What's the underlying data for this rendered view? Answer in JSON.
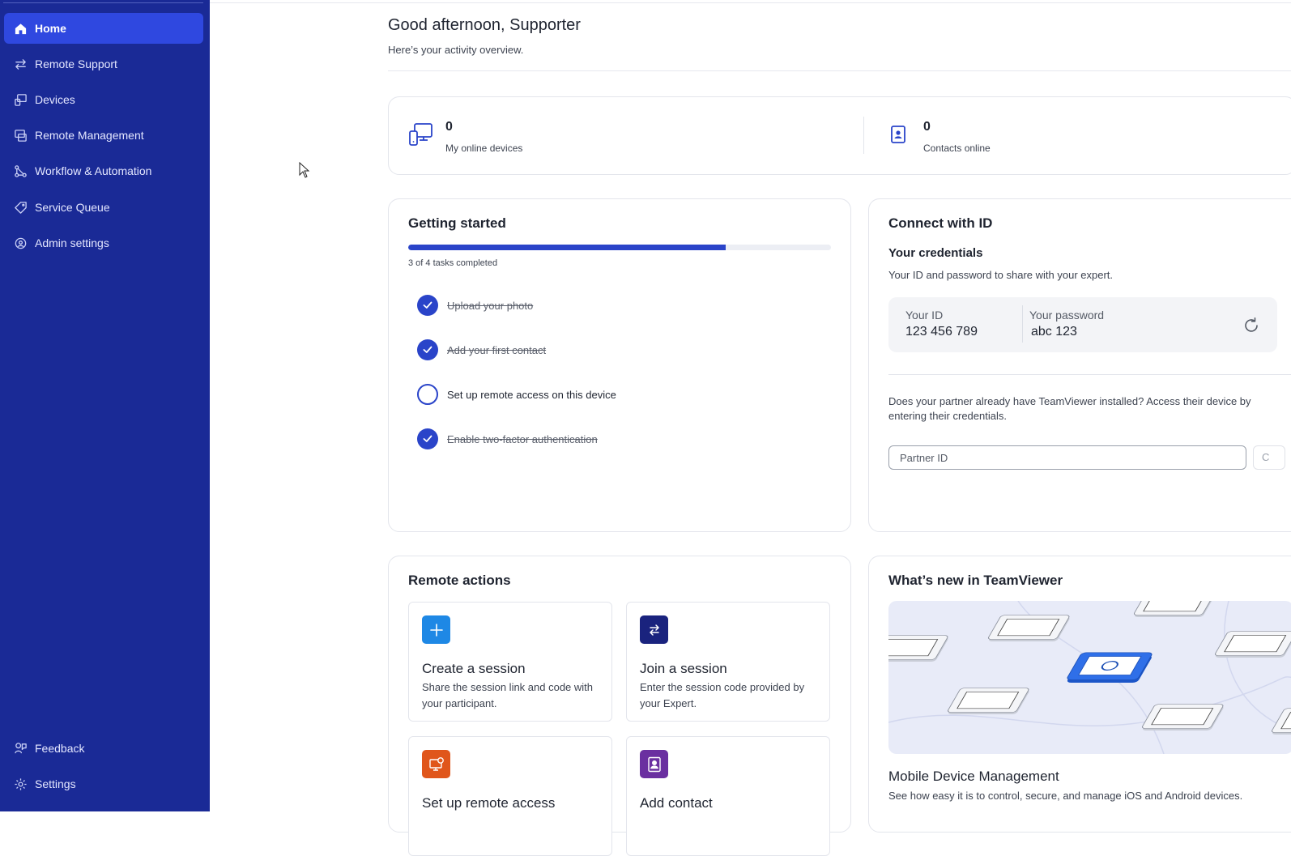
{
  "sidebar": {
    "items": [
      {
        "label": "Home",
        "icon": "home-icon",
        "active": true
      },
      {
        "label": "Remote Support",
        "icon": "arrows-swap-icon"
      },
      {
        "label": "Devices",
        "icon": "devices-icon"
      },
      {
        "label": "Remote Management",
        "icon": "remote-management-icon"
      },
      {
        "label": "Workflow & Automation",
        "icon": "workflow-icon"
      },
      {
        "label": "Service Queue",
        "icon": "tag-icon"
      },
      {
        "label": "Admin settings",
        "icon": "admin-gear-icon"
      }
    ],
    "bottom": [
      {
        "label": "Feedback",
        "icon": "feedback-icon"
      },
      {
        "label": "Settings",
        "icon": "gear-icon"
      }
    ]
  },
  "header": {
    "greeting": "Good afternoon, Supporter",
    "subtitle": "Here’s your activity overview."
  },
  "stats": {
    "devices": {
      "value": "0",
      "label": "My online devices"
    },
    "contacts": {
      "value": "0",
      "label": "Contacts online"
    }
  },
  "getting_started": {
    "title": "Getting started",
    "progress_fraction": 0.75,
    "progress_text": "3 of 4 tasks completed",
    "tasks": [
      {
        "label": "Upload your photo",
        "done": true
      },
      {
        "label": "Add your first contact",
        "done": true
      },
      {
        "label": "Set up remote access on this device",
        "done": false
      },
      {
        "label": "Enable two-factor authentication",
        "done": true
      }
    ]
  },
  "connect": {
    "title": "Connect with ID",
    "credentials_title": "Your credentials",
    "credentials_sub": "Your ID and password to share with your expert.",
    "id_label": "Your ID",
    "id_value": "123 456 789",
    "password_label": "Your password",
    "password_value": "abc 123",
    "partner_text": "Does your partner already have TeamViewer installed? Access their device by entering their credentials.",
    "partner_placeholder": "Partner ID",
    "connect_label": "C"
  },
  "remote_actions": {
    "title": "Remote actions",
    "cards": [
      {
        "title": "Create a session",
        "desc": "Share the session link and code with your participant.",
        "color": "#1e88e5",
        "icon": "plus-icon"
      },
      {
        "title": "Join a session",
        "desc": "Enter the session code provided by your Expert.",
        "color": "#1a237e",
        "icon": "arrows-swap-icon"
      },
      {
        "title": "Set up remote access",
        "desc": "",
        "color": "#e0561b",
        "icon": "monitor-badge-icon"
      },
      {
        "title": "Add contact",
        "desc": "",
        "color": "#6a2fa0",
        "icon": "contact-card-icon"
      }
    ]
  },
  "whats_new": {
    "title": "What’s new in TeamViewer",
    "item_title": "Mobile Device Management",
    "item_desc": "See how easy it is to control, secure, and manage iOS and Android devices."
  },
  "colors": {
    "sidebar_bg": "#1a2a96",
    "active_nav": "#2f48e0",
    "accent": "#2a44c9"
  }
}
